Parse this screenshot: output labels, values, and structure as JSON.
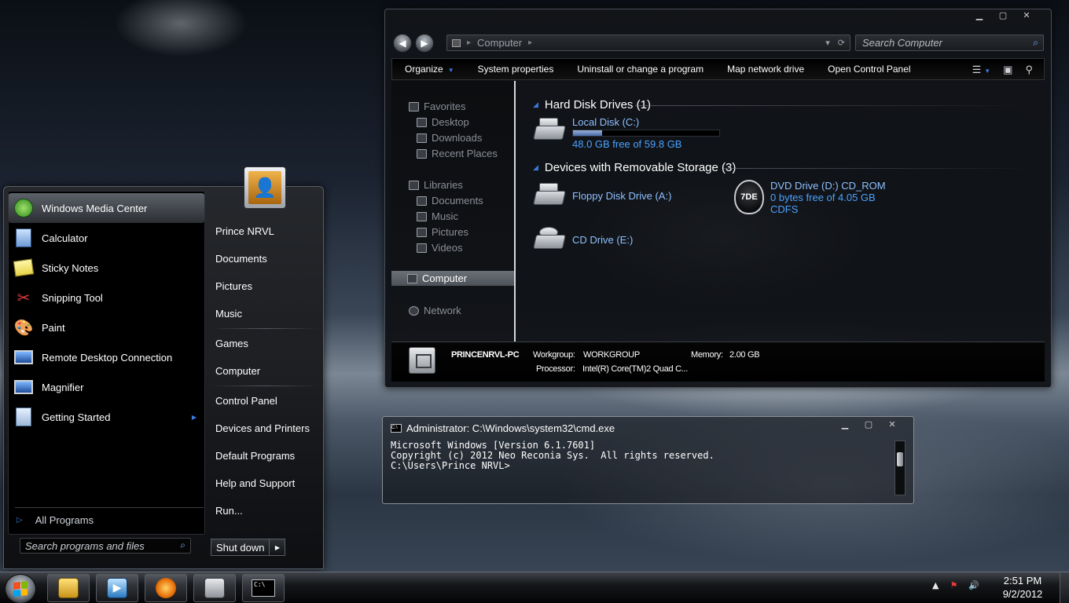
{
  "explorer": {
    "address": {
      "crumb": "Computer"
    },
    "search_placeholder": "Search Computer",
    "window_controls": {
      "minimize": "▁",
      "maximize": "▢",
      "close": "✕"
    },
    "toolbar": {
      "organize": "Organize",
      "system_properties": "System properties",
      "uninstall": "Uninstall or change a program",
      "map_drive": "Map network drive",
      "control_panel": "Open Control Panel"
    },
    "nav": {
      "favorites": "Favorites",
      "desktop": "Desktop",
      "downloads": "Downloads",
      "recent": "Recent Places",
      "libraries": "Libraries",
      "documents": "Documents",
      "music": "Music",
      "pictures": "Pictures",
      "videos": "Videos",
      "computer": "Computer",
      "network": "Network"
    },
    "groups": {
      "hdd": "Hard Disk Drives (1)",
      "removable": "Devices with Removable Storage (3)"
    },
    "drives": {
      "c": {
        "name": "Local Disk (C:)",
        "free": "48.0 GB free of 59.8 GB",
        "used_fraction": 0.197
      },
      "a": {
        "name": "Floppy Disk Drive (A:)"
      },
      "d": {
        "name": "DVD Drive (D:) CD_ROM",
        "free": "0 bytes free of 4.05 GB",
        "fs": "CDFS",
        "badge": "7DE"
      },
      "e": {
        "name": "CD Drive (E:)"
      }
    },
    "details": {
      "pc_name": "PRINCENRVL-PC",
      "workgroup_label": "Workgroup:",
      "workgroup": "WORKGROUP",
      "memory_label": "Memory:",
      "memory": "2.00 GB",
      "processor_label": "Processor:",
      "processor": "Intel(R) Core(TM)2 Quad C..."
    }
  },
  "start_menu": {
    "programs": [
      {
        "label": "Windows Media Center",
        "icon": "media-center-icon"
      },
      {
        "label": "Calculator",
        "icon": "calculator-icon"
      },
      {
        "label": "Sticky Notes",
        "icon": "sticky-notes-icon"
      },
      {
        "label": "Snipping Tool",
        "icon": "snipping-tool-icon"
      },
      {
        "label": "Paint",
        "icon": "paint-icon"
      },
      {
        "label": "Remote Desktop Connection",
        "icon": "remote-desktop-icon"
      },
      {
        "label": "Magnifier",
        "icon": "magnifier-icon"
      },
      {
        "label": "Getting Started",
        "icon": "getting-started-icon"
      }
    ],
    "all_programs": "All Programs",
    "search_placeholder": "Search programs and files",
    "places": {
      "user": "Prince NRVL",
      "documents": "Documents",
      "pictures": "Pictures",
      "music": "Music",
      "games": "Games",
      "computer": "Computer",
      "control_panel": "Control Panel",
      "devices": "Devices and Printers",
      "default_programs": "Default Programs",
      "help": "Help and Support",
      "run": "Run..."
    },
    "shutdown": "Shut down"
  },
  "cmd": {
    "title": "Administrator: C:\\Windows\\system32\\cmd.exe",
    "line1": "Microsoft Windows [Version 6.1.7601]",
    "line2": "Copyright (c) 2012 Neo Reconia Sys.  All rights reserved.",
    "line3": "",
    "line4": "C:\\Users\\Prince NRVL>"
  },
  "taskbar": {
    "time": "2:51 PM",
    "date": "9/2/2012",
    "cmd_icon_text": "C:\\",
    "colors": {
      "accent": "#3b7be0",
      "link": "#4aa3ff"
    }
  }
}
